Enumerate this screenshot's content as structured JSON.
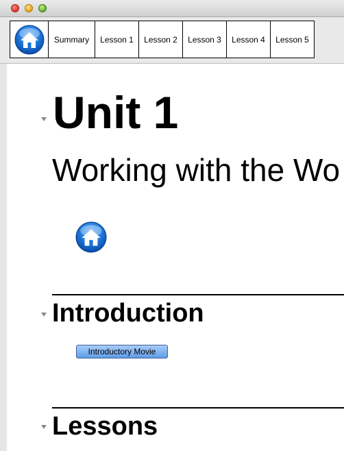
{
  "window": {
    "controls": [
      "close",
      "minimize",
      "zoom"
    ]
  },
  "nav": {
    "home_icon": "home-icon",
    "tabs": [
      {
        "label": "Summary"
      },
      {
        "label": "Lesson 1"
      },
      {
        "label": "Lesson 2"
      },
      {
        "label": "Lesson 3"
      },
      {
        "label": "Lesson 4"
      },
      {
        "label": "Lesson 5"
      }
    ]
  },
  "content": {
    "unit_title": "Unit 1",
    "unit_subtitle": "Working with the Wo",
    "home_icon": "home-icon",
    "sections": [
      {
        "heading": "Introduction",
        "button_label": "Introductory Movie"
      },
      {
        "heading": "Lessons"
      }
    ]
  },
  "colors": {
    "home_icon_blue": "#1a73d6",
    "button_blue": "#6aa6ec",
    "close": "#d8362b",
    "minimize": "#e0a21a",
    "zoom": "#5fae2b"
  }
}
